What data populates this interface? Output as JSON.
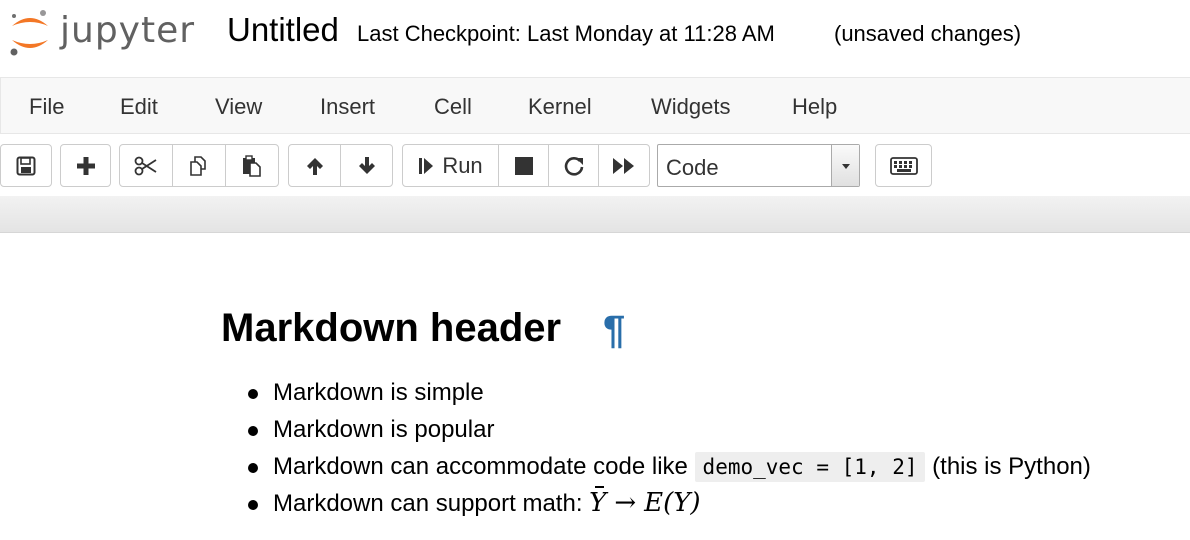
{
  "header": {
    "logo_text": "jupyter",
    "notebook_title": "Untitled",
    "checkpoint": "Last Checkpoint: Last Monday at 11:28 AM",
    "status": "(unsaved changes)"
  },
  "menubar": {
    "items": [
      "File",
      "Edit",
      "View",
      "Insert",
      "Cell",
      "Kernel",
      "Widgets",
      "Help"
    ]
  },
  "toolbar": {
    "icons": [
      "save-icon",
      "plus-icon",
      "scissors-icon",
      "copy-icon",
      "paste-icon",
      "arrow-up-icon",
      "arrow-down-icon",
      "step-forward-icon",
      "stop-icon",
      "restart-icon",
      "fast-forward-icon",
      "keyboard-icon"
    ],
    "run_label": "Run",
    "cell_type": "Code"
  },
  "cell": {
    "heading": "Markdown header",
    "anchor": "¶",
    "bullets": {
      "b1": "Markdown is simple",
      "b2": "Markdown is popular",
      "b3_prefix": "Markdown can accommodate code like",
      "b3_code": "demo_vec = [1, 2]",
      "b3_suffix": "(this is Python)",
      "b4_prefix": "Markdown can support math:",
      "math_lhs": "Y",
      "math_arrow": "→",
      "math_rhs": "E(Y)"
    }
  },
  "colors": {
    "anchor": "#296eaa",
    "menubar_bg": "#f8f8f8",
    "logo_orange": "#f37726",
    "logo_gray": "#616161"
  }
}
